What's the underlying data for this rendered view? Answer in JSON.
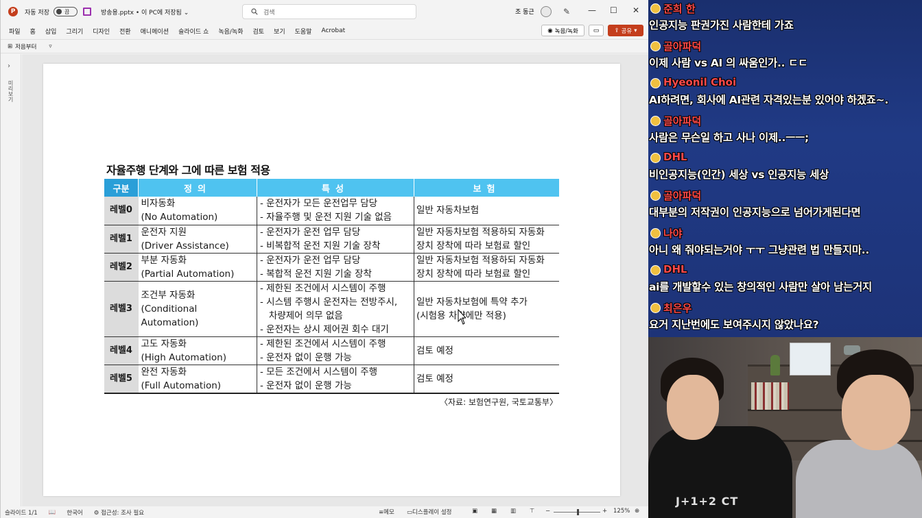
{
  "titlebar": {
    "app_icon_letter": "P",
    "autosave_label": "자동 저장",
    "autosave_state": "끔",
    "filename": "방송용.pptx • 이 PC에 저장됨",
    "filename_chevron": "⌄",
    "search_placeholder": "검색",
    "user_name": "조 동근",
    "minimize": "—",
    "maximize": "☐",
    "close": "✕"
  },
  "menu": {
    "items": [
      "파일",
      "홈",
      "삽입",
      "그리기",
      "디자인",
      "전환",
      "애니메이션",
      "슬라이드 쇼",
      "녹음/녹화",
      "검토",
      "보기",
      "도움말",
      "Acrobat"
    ],
    "record_label": "녹음/녹화",
    "share_label": "공유"
  },
  "ribbon": {
    "quick_label": "저음부터",
    "dropdown": "▿"
  },
  "thumbs": {
    "expand": "›",
    "label": "미리보기"
  },
  "slide": {
    "title": "자율주행 단계와 그에 따른 보험 적용",
    "headers": [
      "구분",
      "정의",
      "특성",
      "보험"
    ],
    "rows": [
      {
        "level": "레벨0",
        "def1": "비자동화",
        "def2": "(No Automation)",
        "feat": [
          "- 운전자가 모든 운전업무 담당",
          "- 자율주행 및 운전 지원 기술 없음"
        ],
        "ins": [
          "일반 자동차보험"
        ]
      },
      {
        "level": "레벨1",
        "def1": "운전자 지원",
        "def2": "(Driver Assistance)",
        "feat": [
          "- 운전자가 운전 업무 담당",
          "- 비복합적 운전 지원 기술 장착"
        ],
        "ins": [
          "일반 자동차보험 적용하되 자동화",
          "장치 장착에 따라 보험료 할인"
        ]
      },
      {
        "level": "레벨2",
        "def1": "부분 자동화",
        "def2": "(Partial Automation)",
        "feat": [
          "- 운전자가 운전 업무 담당",
          "- 복합적 운전 지원 기술 장착"
        ],
        "ins": [
          "일반 자동차보험 적용하되 자동화",
          "장치 장착에 따라 보험료 할인"
        ]
      },
      {
        "level": "레벨3",
        "def1": "조건부 자동화",
        "def2": "(Conditional Automation)",
        "feat": [
          "- 제한된 조건에서 시스템이 주행",
          "- 시스템 주행시 운전자는 전방주시,",
          "   차량제어 의무 없음",
          "- 운전자는 상시 제어권 회수 대기"
        ],
        "ins": [
          "일반 자동차보험에 특약 추가",
          "(시험용 차량에만 적용)"
        ]
      },
      {
        "level": "레벨4",
        "def1": "고도 자동화",
        "def2": "(High Automation)",
        "feat": [
          "- 제한된 조건에서 시스템이 주행",
          "- 운전자 없이 운행 가능"
        ],
        "ins": [
          "검토 예정"
        ]
      },
      {
        "level": "레벨5",
        "def1": "완전 자동화",
        "def2": "(Full Automation)",
        "feat": [
          "- 모든 조건에서 시스템이 주행",
          "- 운전자 없이 운행 가능"
        ],
        "ins": [
          "검토 예정"
        ]
      }
    ],
    "source": "〈자료: 보험연구원, 국토교통부〉"
  },
  "status": {
    "slide_count": "슬라이드 1/1",
    "language": "한국어",
    "accessibility": "접근성: 조사 필요",
    "notes": "메모",
    "display": "디스플레이 설정",
    "zoom": "125%"
  },
  "chat": {
    "messages": [
      {
        "name": "준희 한",
        "text": "인공지능 판권가진 사람한테 가죠",
        "color": "#ff4a4a"
      },
      {
        "name": "골아파덕",
        "text": "이제 사람 vs AI 의 싸움인가.. ㄷㄷ",
        "color": "#ff4a4a"
      },
      {
        "name": "Hyeonil Choi",
        "text": "AI하려면, 회사에 AI관련 자격있는분 있어야 하겠죠~.",
        "color": "#ff4a4a"
      },
      {
        "name": "골아파덕",
        "text": "사람은 무슨일 하고 사나 이제..ㅡㅡ;",
        "color": "#ff4a4a"
      },
      {
        "name": "DHL",
        "text": "비인공지능(인간) 세상 vs 인공지능 세상",
        "color": "#ff4a4a"
      },
      {
        "name": "골아파덕",
        "text": "대부분의 저작권이 인공지능으로 넘어가게된다면",
        "color": "#ff4a4a"
      },
      {
        "name": "나야",
        "text": "아니 왜 줘야되는거야 ㅜㅜ 그냥관련 법 만들지마..",
        "color": "#ff4a4a"
      },
      {
        "name": "DHL",
        "text": "ai를 개발할수 있는 창의적인 사람만 살아 남는거지",
        "color": "#ff4a4a"
      },
      {
        "name": "최은우",
        "text": "요거 지난번에도 보여주시지 않았나요?",
        "color": "#ff4a4a"
      }
    ]
  },
  "cam": {
    "shirt_text": "J+1+2 CT"
  }
}
